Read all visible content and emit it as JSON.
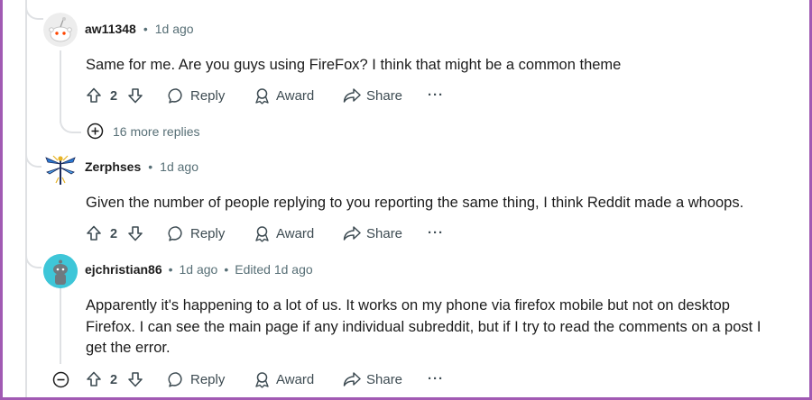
{
  "comments": [
    {
      "username": "aw11348",
      "time": "1d ago",
      "edited": "",
      "body": [
        "Same for me. Are you guys using FireFox? I think that might be a common theme"
      ],
      "votes": "2",
      "avatar_icon": "reddit-snoo-icon"
    },
    {
      "username": "Zerphses",
      "time": "1d ago",
      "edited": "",
      "body": [
        "Given the number of people replying to you reporting the same thing, I think Reddit made a whoops."
      ],
      "votes": "2",
      "avatar_icon": "dragonfly-icon"
    },
    {
      "username": "ejchristian86",
      "time": "1d ago",
      "edited": "Edited 1d ago",
      "body": [
        "Apparently it's happening to a lot of us. It works on my phone via firefox mobile but not on desktop",
        "Firefox. I can see the main page if any individual subreddit, but if I try to read the comments on a post I",
        "get the error."
      ],
      "votes": "2",
      "avatar_icon": "snoo-avatar-icon"
    }
  ],
  "actions": {
    "reply": "Reply",
    "award": "Award",
    "share": "Share",
    "more": "···"
  },
  "more_replies": "16 more replies",
  "separator": "•",
  "colors": {
    "frame": "#a15ab3",
    "thread": "#dfe1e4",
    "meta_text": "#576f76",
    "teal_avatar": "#3ec6d8"
  }
}
